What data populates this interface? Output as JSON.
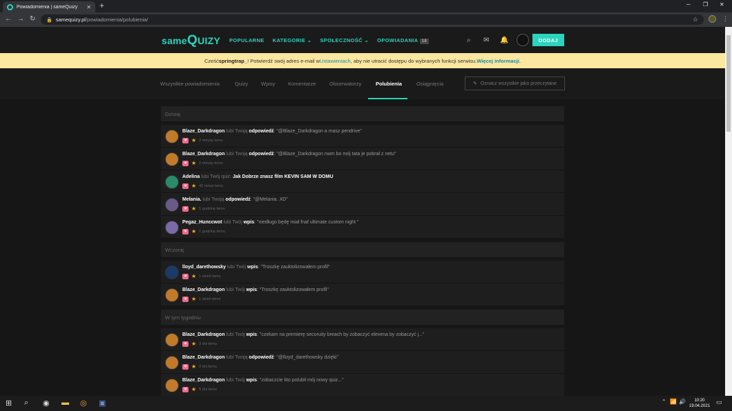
{
  "browser": {
    "tab_title": "Powiadomienia | sameQuizy",
    "url_host": "samequizy.pl",
    "url_path": "/powiadomienia/polubienia/"
  },
  "header": {
    "logo_same": "same",
    "logo_q": "Q",
    "logo_uizy": "UIZY",
    "nav": [
      "POPULARNE",
      "KATEGORIE",
      "SPOŁECZNOŚĆ",
      "OPOWIADANIA"
    ],
    "nav_badge": "18",
    "add_button": "DODAJ"
  },
  "notice": {
    "greeting": "Cześć ",
    "username": "springtrap_",
    "text1": "! Potwierdź swój adres e-mail w ",
    "settings_link": "Ustawieniach",
    "text2": ", aby nie utracić dostępu do wybranych funkcji serwisu. ",
    "more_link": "Więcej informacji",
    "text3": "."
  },
  "subnav": {
    "items": [
      "Wszystkie powiadomienia",
      "Quizy",
      "Wpisy",
      "Komentarze",
      "Obserwatorzy",
      "Polubienia",
      "Osiągnięcia"
    ],
    "active": "Polubienia",
    "mark_all": "Oznacz wszystkie jako przeczytane"
  },
  "sections": [
    {
      "title": "Dzisiaj",
      "items": [
        {
          "user": "Blaze_Darkdragon",
          "verb": " lubi Twoją ",
          "kind": "odpowiedź",
          "text": ": \"@Blaze_Darkdragon a masz pendrive\"",
          "time": "2 minuty temu",
          "avatar": "#c07a2a"
        },
        {
          "user": "Blaze_Darkdragon",
          "verb": " lubi Twoją ",
          "kind": "odpowiedź",
          "text": ": \"@Blaze_Darkdragon nwm bo mój tata je pobrał z netu\"",
          "time": "2 minuty temu",
          "avatar": "#c07a2a"
        },
        {
          "user": "Adelina",
          "verb": " lubi Twój quiz: ",
          "kind": "Jak Dobrze znasz film KEVIN SAM W DOMU",
          "text": "",
          "time": "40 minut temu",
          "avatar": "#2a8a6a"
        },
        {
          "user": "Melania.",
          "verb": " lubi Twoją ",
          "kind": "odpowiedź",
          "text": ": \"@Melania. XD\"",
          "time": "1 godzinę temu",
          "avatar": "#6a5a8a"
        },
        {
          "user": "Pegaz_Hunccwot",
          "verb": " lubi Twój ",
          "kind": "wpis",
          "text": ": \"niedługo będę miał fnaf ultimate custom night \"",
          "time": "1 godzinę temu",
          "avatar": "#7a6aa8"
        }
      ]
    },
    {
      "title": "Wczoraj",
      "items": [
        {
          "user": "lloyd_darethowsky",
          "verb": " lubi Twój ",
          "kind": "wpis",
          "text": ": \"Troszkę zauktolizowałem profil\"",
          "time": "1 dzień temu",
          "avatar": "#1a3a6a"
        },
        {
          "user": "Blaze_Darkdragon",
          "verb": " lubi Twój ",
          "kind": "wpis",
          "text": ": \"Troszkę zauktolizowałem profil\"",
          "time": "1 dzień temu",
          "avatar": "#c07a2a"
        }
      ]
    },
    {
      "title": "W tym tygodniu",
      "items": [
        {
          "user": "Blaze_Darkdragon",
          "verb": " lubi Twój ",
          "kind": "wpis",
          "text": ": \"czekam na premierę secoruity breach by zobaczyć elevena by zobaczyć j...\"",
          "time": "3 dni temu",
          "avatar": "#c07a2a"
        },
        {
          "user": "Blaze_Darkdragon",
          "verb": " lubi Twoją ",
          "kind": "odpowiedź",
          "text": ": \"@lloyd_darethowsky dzięki\"",
          "time": "3 dni temu",
          "avatar": "#c07a2a"
        },
        {
          "user": "Blaze_Darkdragon",
          "verb": " lubi Twój ",
          "kind": "wpis",
          "text": ": \"zobaczcie kto polubił mój nowy quiz...\"",
          "time": "5 dni temu",
          "avatar": "#c07a2a"
        }
      ]
    }
  ],
  "taskbar": {
    "time": "10:20",
    "date": "19.04.2021"
  }
}
